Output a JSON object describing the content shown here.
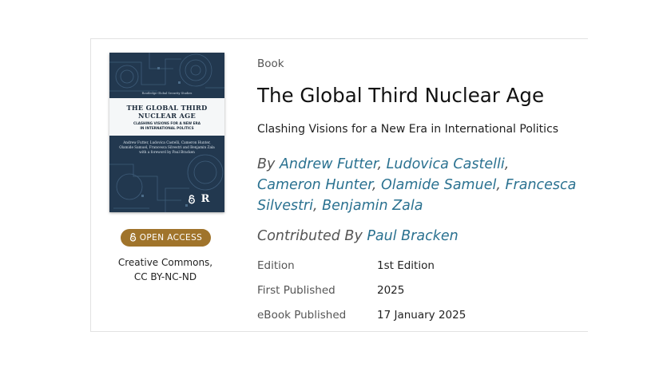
{
  "cover": {
    "series": "Routledge Global Security Studies",
    "title": "THE GLOBAL THIRD\nNUCLEAR AGE",
    "subtitle": "CLASHING VISIONS FOR A NEW ERA\nIN INTERNATIONAL POLITICS",
    "authors": "Andrew Futter, Ludovica Castelli, Cameron Hunter, Olamide Samuel, Francesca Silvestri and Benjamin Zala",
    "foreword": "with a foreword by Paul Bracken",
    "publisher_mark": "R"
  },
  "access": {
    "badge": "OPEN ACCESS",
    "license_line1": "Creative Commons,",
    "license_line2": "CC BY-NC-ND",
    "badge_color": "#a0742b"
  },
  "book": {
    "type_label": "Book",
    "title": "The Global Third Nuclear Age",
    "subtitle": "Clashing Visions for a New Era in International Politics",
    "by_prefix": "By",
    "authors": [
      "Andrew Futter",
      "Ludovica Castelli",
      "Cameron Hunter",
      "Olamide Samuel",
      "Francesca Silvestri",
      "Benjamin Zala"
    ],
    "contributed_prefix": "Contributed By",
    "contributor": "Paul Bracken",
    "link_color": "#2a7190"
  },
  "meta": {
    "edition_label": "Edition",
    "edition_value": "1st Edition",
    "first_published_label": "First Published",
    "first_published_value": "2025",
    "ebook_label": "eBook Published",
    "ebook_value": "17 January 2025"
  }
}
